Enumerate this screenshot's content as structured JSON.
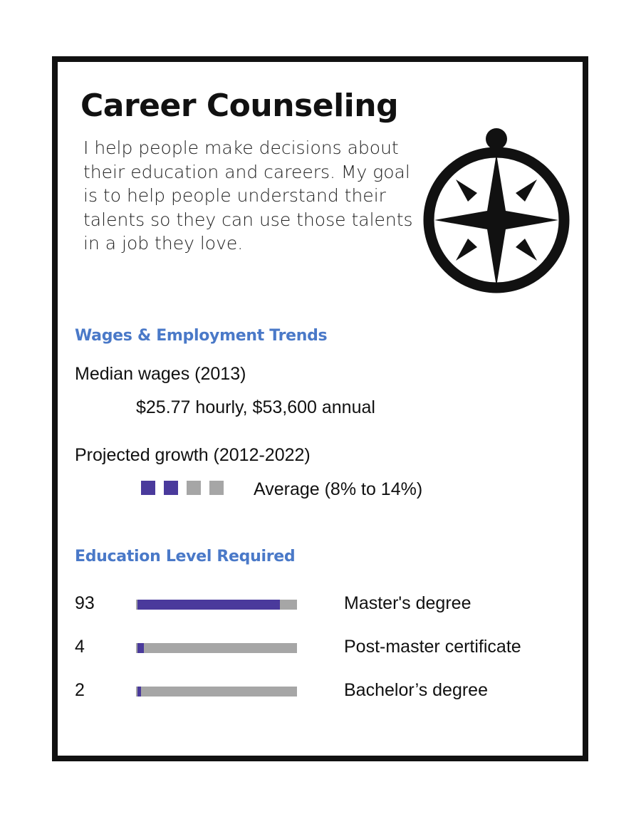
{
  "title": "Career Counseling",
  "description": "I help people make decisions about their education and careers.  My goal is to help people understand their talents so they can use those talents in a job they love.",
  "icon": "compass-icon",
  "colors": {
    "accent": "#4a79c8",
    "filled": "#4a3a9c",
    "empty": "#a6a6a6",
    "border": "#111111"
  },
  "wages": {
    "heading": "Wages &  Employment Trends",
    "median_label": "Median wages (2013)",
    "median_value": "$25.77 hourly, $53,600 annual",
    "growth_label": "Projected growth (2012-2022)",
    "growth_filled": 2,
    "growth_total": 4,
    "growth_value": "Average (8% to 14%)"
  },
  "education": {
    "heading": "Education Level Required",
    "rows": [
      {
        "value": "93",
        "percent": 93,
        "label": "Master's degree"
      },
      {
        "value": "4",
        "percent": 4,
        "label": "Post-master certificate"
      },
      {
        "value": "2",
        "percent": 2,
        "label": "Bachelor’s degree"
      }
    ]
  }
}
